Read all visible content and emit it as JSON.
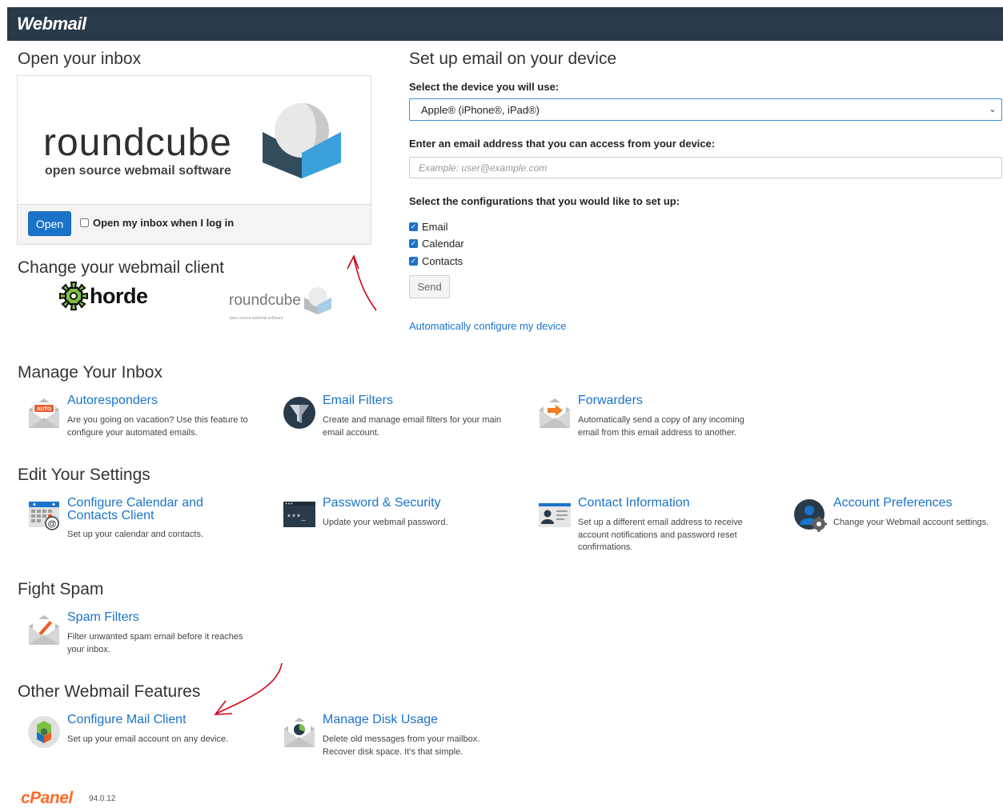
{
  "header": {
    "brand": "Webmail"
  },
  "open_inbox": {
    "heading": "Open your inbox",
    "logo_word": "roundcube",
    "logo_sub": "open source webmail software",
    "open_button": "Open",
    "auto_open_label": "Open my inbox when I log in"
  },
  "change_client": {
    "heading": "Change your webmail client",
    "horde_label": "horde",
    "roundcube_label": "roundcube",
    "roundcube_sub": "open source webmail software"
  },
  "setup_device": {
    "heading": "Set up email on your device",
    "device_label": "Select the device you will use:",
    "device_selected": "Apple® (iPhone®, iPad®)",
    "email_label": "Enter an email address that you can access from your device:",
    "email_placeholder": "Example: user@example.com",
    "config_label": "Select the configurations that you would like to set up:",
    "configs": [
      "Email",
      "Calendar",
      "Contacts"
    ],
    "send_button": "Send",
    "auto_config_link": "Automatically configure my device"
  },
  "manage_inbox": {
    "heading": "Manage Your Inbox",
    "items": [
      {
        "title": "Autoresponders",
        "desc": "Are you going on vacation? Use this feature to configure your automated emails."
      },
      {
        "title": "Email Filters",
        "desc": "Create and manage email filters for your main email account."
      },
      {
        "title": "Forwarders",
        "desc": "Automatically send a copy of any incoming email from this email address to another."
      }
    ]
  },
  "edit_settings": {
    "heading": "Edit Your Settings",
    "items": [
      {
        "title": "Configure Calendar and Contacts Client",
        "desc": "Set up your calendar and contacts."
      },
      {
        "title": "Password & Security",
        "desc": "Update your webmail password."
      },
      {
        "title": "Contact Information",
        "desc": "Set up a different email address to receive account notifications and password reset confirmations."
      },
      {
        "title": "Account Preferences",
        "desc": "Change your Webmail account settings."
      }
    ]
  },
  "fight_spam": {
    "heading": "Fight Spam",
    "items": [
      {
        "title": "Spam Filters",
        "desc": "Filter unwanted spam email before it reaches your inbox."
      }
    ]
  },
  "other_features": {
    "heading": "Other Webmail Features",
    "items": [
      {
        "title": "Configure Mail Client",
        "desc": "Set up your email account on any device."
      },
      {
        "title": "Manage Disk Usage",
        "desc": "Delete old messages from your mailbox. Recover disk space. It’s that simple."
      }
    ]
  },
  "footer": {
    "logo": "cPanel",
    "version": "94.0.12"
  },
  "icons": {
    "autoresponders": "envelope-auto-icon",
    "email_filters": "funnel-icon",
    "forwarders": "envelope-arrow-icon",
    "calendar": "calendar-icon",
    "password": "password-terminal-icon",
    "contact": "contact-card-icon",
    "preferences": "user-gear-icon",
    "spam": "envelope-pencil-icon",
    "mail_client": "mail-client-icon",
    "disk": "envelope-pie-icon"
  },
  "colors": {
    "header_bg": "#293a4a",
    "link": "#1a73c9",
    "cpanel": "#ff6c2c",
    "annotation": "#d0021b"
  }
}
